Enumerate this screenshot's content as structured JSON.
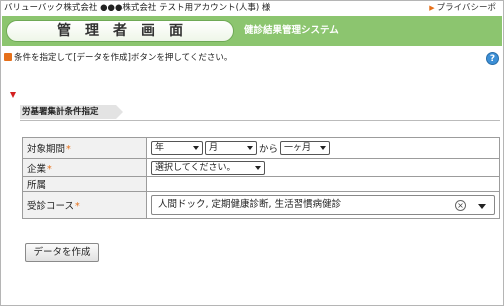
{
  "header": {
    "company_line": "バリューバック株式会社 ●●●株式会社 テスト用アカウント(人事) 様",
    "privacy_link": "プライバシーポ",
    "privacy_arrow": "▶"
  },
  "banner": {
    "title": "管理者画面",
    "subtitle": "健診結果管理システム",
    "color": "#8cc56f"
  },
  "instruction": "条件を指定して[データを作成]ボタンを押してください。",
  "help_icon": "help-icon",
  "section": {
    "title": "労基署集計条件指定"
  },
  "form": {
    "period": {
      "label": "対象期間",
      "required_mark": "*",
      "year_value": "年",
      "month_value": "月",
      "connector": "から",
      "span_value": "一ヶ月"
    },
    "company": {
      "label": "企業",
      "required_mark": "*",
      "value": "選択してください。"
    },
    "department": {
      "label": "所属"
    },
    "course": {
      "label": "受診コース",
      "required_mark": "*",
      "value": "人間ドック, 定期健康診断, 生活習慣病健診",
      "clear_symbol": "×"
    }
  },
  "actions": {
    "create_label": "データを作成"
  },
  "colors": {
    "accent": "#e6701a",
    "section_marker": "#d42020",
    "label_bg": "#f1f1f1"
  }
}
